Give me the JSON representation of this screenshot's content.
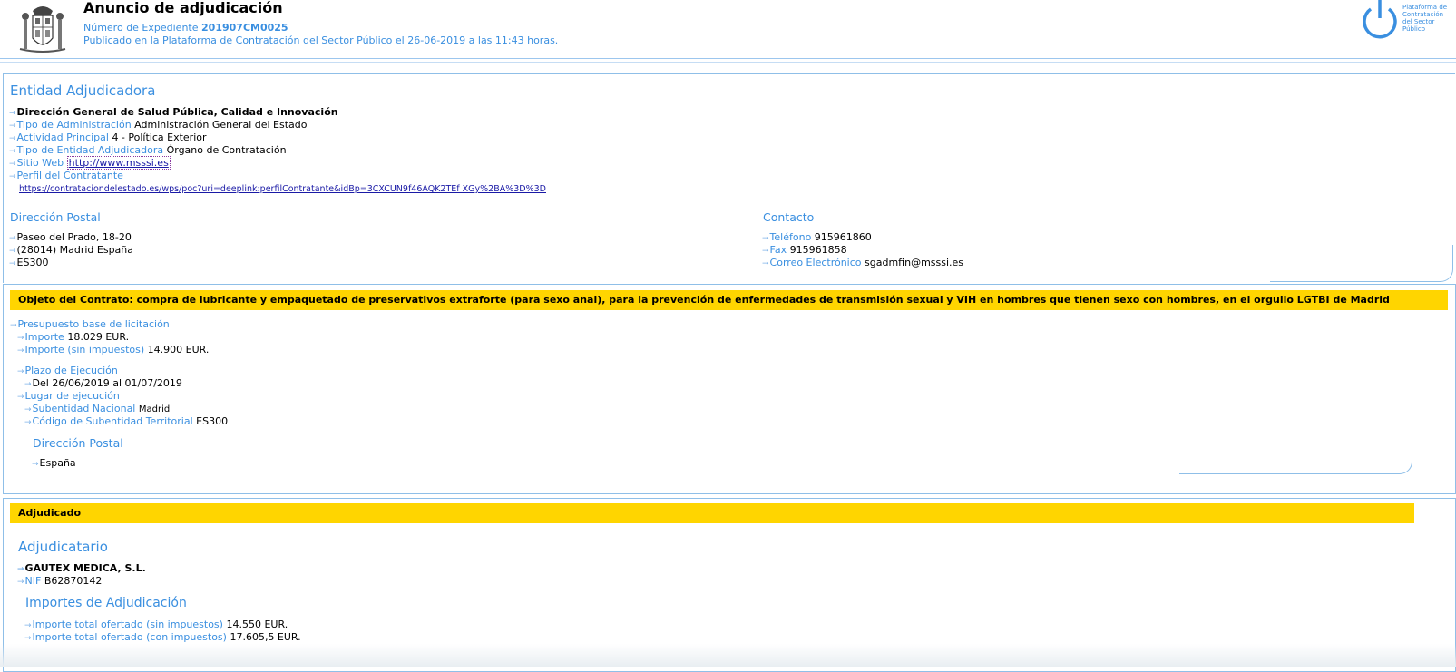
{
  "header": {
    "title": "Anuncio de adjudicación",
    "expediente_label": "Número de Expediente",
    "expediente_value": "201907CM0025",
    "published": "Publicado en la Plataforma de Contratación del Sector Público el 26-06-2019 a las 11:43 horas.",
    "platform_logo_text": "Plataforma de Contratación del Sector Público"
  },
  "entidad": {
    "heading": "Entidad Adjudicadora",
    "name": "Dirección General de Salud Pública, Calidad e Innovación",
    "fields": [
      {
        "label": "Tipo de Administración",
        "value": "Administración General del Estado"
      },
      {
        "label": "Actividad Principal",
        "value": "4 - Política Exterior"
      },
      {
        "label": "Tipo de Entidad Adjudicadora",
        "value": "Órgano de Contratación"
      }
    ],
    "web_label": "Sitio Web",
    "web_value": "http://www.msssi.es",
    "perfil_label": "Perfil del Contratante",
    "perfil_url": "https://contrataciondelestado.es/wps/poc?uri=deeplink:perfilContratante&idBp=3CXCUN9f46AQK2TEf XGy%2BA%3D%3D",
    "postal": {
      "heading": "Dirección Postal",
      "lines": [
        "Paseo del Prado, 18-20",
        "(28014) Madrid España",
        "ES300"
      ]
    },
    "contacto": {
      "heading": "Contacto",
      "fields": [
        {
          "label": "Teléfono",
          "value": "915961860"
        },
        {
          "label": "Fax",
          "value": "915961858"
        },
        {
          "label": "Correo Electrónico",
          "value": "sgadmfin@msssi.es"
        }
      ]
    }
  },
  "objeto": {
    "band": "Objeto del Contrato: compra de lubricante y empaquetado de preservativos extraforte (para sexo anal), para la prevención de enfermedades de transmisión sexual y VIH en hombres que tienen sexo con hombres, en el orgullo LGTBI de Madrid",
    "presupuesto_label": "Presupuesto base de licitación",
    "importe_label": "Importe",
    "importe_value": "18.029 EUR.",
    "importe_sin_label": "Importe (sin impuestos)",
    "importe_sin_value": "14.900 EUR.",
    "plazo_label": "Plazo de Ejecución",
    "plazo_value": "Del 26/06/2019 al 01/07/2019",
    "lugar_label": "Lugar de ejecución",
    "subentidad_label": "Subentidad Nacional",
    "subentidad_value": "Madrid",
    "codigo_label": "Código de Subentidad Territorial",
    "codigo_value": "ES300",
    "postal_heading": "Dirección Postal",
    "postal_value": "España"
  },
  "adjudicado": {
    "band": "Adjudicado",
    "heading": "Adjudicatario",
    "company": "GAUTEX MEDICA, S.L.",
    "nif_label": "NIF",
    "nif_value": "B62870142",
    "importes_heading": "Importes de Adjudicación",
    "total_sin_label": "Importe total ofertado (sin impuestos)",
    "total_sin_value": "14.550 EUR.",
    "total_con_label": "Importe total ofertado (con impuestos)",
    "total_con_value": "17.605,5 EUR."
  }
}
